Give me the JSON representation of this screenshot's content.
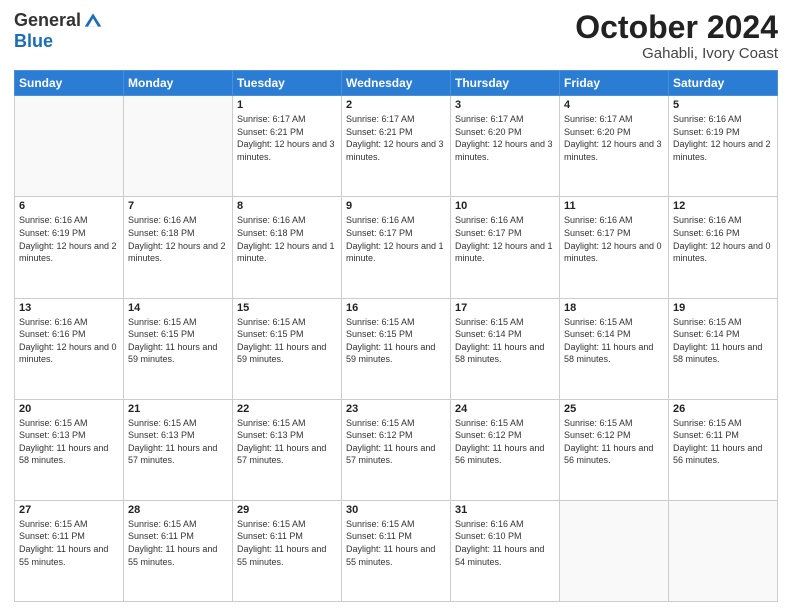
{
  "header": {
    "logo_general": "General",
    "logo_blue": "Blue",
    "month_title": "October 2024",
    "location": "Gahabli, Ivory Coast"
  },
  "days_of_week": [
    "Sunday",
    "Monday",
    "Tuesday",
    "Wednesday",
    "Thursday",
    "Friday",
    "Saturday"
  ],
  "weeks": [
    [
      {
        "day": "",
        "sunrise": "",
        "sunset": "",
        "daylight": ""
      },
      {
        "day": "",
        "sunrise": "",
        "sunset": "",
        "daylight": ""
      },
      {
        "day": "1",
        "sunrise": "Sunrise: 6:17 AM",
        "sunset": "Sunset: 6:21 PM",
        "daylight": "Daylight: 12 hours and 3 minutes."
      },
      {
        "day": "2",
        "sunrise": "Sunrise: 6:17 AM",
        "sunset": "Sunset: 6:21 PM",
        "daylight": "Daylight: 12 hours and 3 minutes."
      },
      {
        "day": "3",
        "sunrise": "Sunrise: 6:17 AM",
        "sunset": "Sunset: 6:20 PM",
        "daylight": "Daylight: 12 hours and 3 minutes."
      },
      {
        "day": "4",
        "sunrise": "Sunrise: 6:17 AM",
        "sunset": "Sunset: 6:20 PM",
        "daylight": "Daylight: 12 hours and 3 minutes."
      },
      {
        "day": "5",
        "sunrise": "Sunrise: 6:16 AM",
        "sunset": "Sunset: 6:19 PM",
        "daylight": "Daylight: 12 hours and 2 minutes."
      }
    ],
    [
      {
        "day": "6",
        "sunrise": "Sunrise: 6:16 AM",
        "sunset": "Sunset: 6:19 PM",
        "daylight": "Daylight: 12 hours and 2 minutes."
      },
      {
        "day": "7",
        "sunrise": "Sunrise: 6:16 AM",
        "sunset": "Sunset: 6:18 PM",
        "daylight": "Daylight: 12 hours and 2 minutes."
      },
      {
        "day": "8",
        "sunrise": "Sunrise: 6:16 AM",
        "sunset": "Sunset: 6:18 PM",
        "daylight": "Daylight: 12 hours and 1 minute."
      },
      {
        "day": "9",
        "sunrise": "Sunrise: 6:16 AM",
        "sunset": "Sunset: 6:17 PM",
        "daylight": "Daylight: 12 hours and 1 minute."
      },
      {
        "day": "10",
        "sunrise": "Sunrise: 6:16 AM",
        "sunset": "Sunset: 6:17 PM",
        "daylight": "Daylight: 12 hours and 1 minute."
      },
      {
        "day": "11",
        "sunrise": "Sunrise: 6:16 AM",
        "sunset": "Sunset: 6:17 PM",
        "daylight": "Daylight: 12 hours and 0 minutes."
      },
      {
        "day": "12",
        "sunrise": "Sunrise: 6:16 AM",
        "sunset": "Sunset: 6:16 PM",
        "daylight": "Daylight: 12 hours and 0 minutes."
      }
    ],
    [
      {
        "day": "13",
        "sunrise": "Sunrise: 6:16 AM",
        "sunset": "Sunset: 6:16 PM",
        "daylight": "Daylight: 12 hours and 0 minutes."
      },
      {
        "day": "14",
        "sunrise": "Sunrise: 6:15 AM",
        "sunset": "Sunset: 6:15 PM",
        "daylight": "Daylight: 11 hours and 59 minutes."
      },
      {
        "day": "15",
        "sunrise": "Sunrise: 6:15 AM",
        "sunset": "Sunset: 6:15 PM",
        "daylight": "Daylight: 11 hours and 59 minutes."
      },
      {
        "day": "16",
        "sunrise": "Sunrise: 6:15 AM",
        "sunset": "Sunset: 6:15 PM",
        "daylight": "Daylight: 11 hours and 59 minutes."
      },
      {
        "day": "17",
        "sunrise": "Sunrise: 6:15 AM",
        "sunset": "Sunset: 6:14 PM",
        "daylight": "Daylight: 11 hours and 58 minutes."
      },
      {
        "day": "18",
        "sunrise": "Sunrise: 6:15 AM",
        "sunset": "Sunset: 6:14 PM",
        "daylight": "Daylight: 11 hours and 58 minutes."
      },
      {
        "day": "19",
        "sunrise": "Sunrise: 6:15 AM",
        "sunset": "Sunset: 6:14 PM",
        "daylight": "Daylight: 11 hours and 58 minutes."
      }
    ],
    [
      {
        "day": "20",
        "sunrise": "Sunrise: 6:15 AM",
        "sunset": "Sunset: 6:13 PM",
        "daylight": "Daylight: 11 hours and 58 minutes."
      },
      {
        "day": "21",
        "sunrise": "Sunrise: 6:15 AM",
        "sunset": "Sunset: 6:13 PM",
        "daylight": "Daylight: 11 hours and 57 minutes."
      },
      {
        "day": "22",
        "sunrise": "Sunrise: 6:15 AM",
        "sunset": "Sunset: 6:13 PM",
        "daylight": "Daylight: 11 hours and 57 minutes."
      },
      {
        "day": "23",
        "sunrise": "Sunrise: 6:15 AM",
        "sunset": "Sunset: 6:12 PM",
        "daylight": "Daylight: 11 hours and 57 minutes."
      },
      {
        "day": "24",
        "sunrise": "Sunrise: 6:15 AM",
        "sunset": "Sunset: 6:12 PM",
        "daylight": "Daylight: 11 hours and 56 minutes."
      },
      {
        "day": "25",
        "sunrise": "Sunrise: 6:15 AM",
        "sunset": "Sunset: 6:12 PM",
        "daylight": "Daylight: 11 hours and 56 minutes."
      },
      {
        "day": "26",
        "sunrise": "Sunrise: 6:15 AM",
        "sunset": "Sunset: 6:11 PM",
        "daylight": "Daylight: 11 hours and 56 minutes."
      }
    ],
    [
      {
        "day": "27",
        "sunrise": "Sunrise: 6:15 AM",
        "sunset": "Sunset: 6:11 PM",
        "daylight": "Daylight: 11 hours and 55 minutes."
      },
      {
        "day": "28",
        "sunrise": "Sunrise: 6:15 AM",
        "sunset": "Sunset: 6:11 PM",
        "daylight": "Daylight: 11 hours and 55 minutes."
      },
      {
        "day": "29",
        "sunrise": "Sunrise: 6:15 AM",
        "sunset": "Sunset: 6:11 PM",
        "daylight": "Daylight: 11 hours and 55 minutes."
      },
      {
        "day": "30",
        "sunrise": "Sunrise: 6:15 AM",
        "sunset": "Sunset: 6:11 PM",
        "daylight": "Daylight: 11 hours and 55 minutes."
      },
      {
        "day": "31",
        "sunrise": "Sunrise: 6:16 AM",
        "sunset": "Sunset: 6:10 PM",
        "daylight": "Daylight: 11 hours and 54 minutes."
      },
      {
        "day": "",
        "sunrise": "",
        "sunset": "",
        "daylight": ""
      },
      {
        "day": "",
        "sunrise": "",
        "sunset": "",
        "daylight": ""
      }
    ]
  ]
}
